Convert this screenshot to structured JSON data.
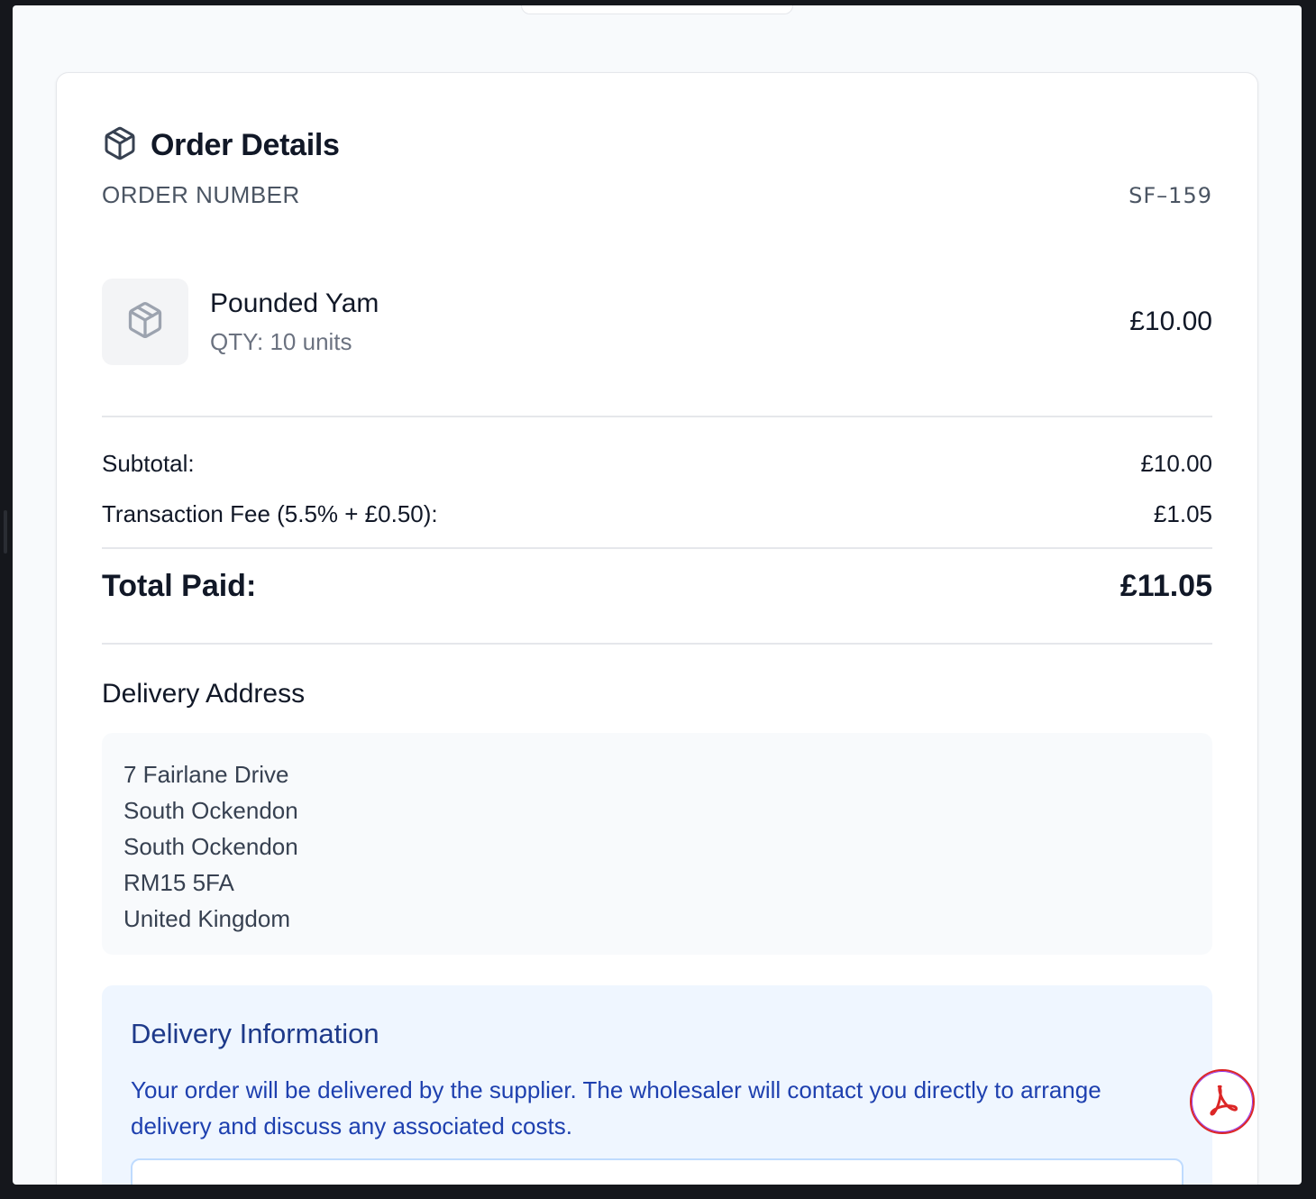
{
  "order": {
    "title": "Order Details",
    "number_label": "ORDER NUMBER",
    "number_value": "SF–159"
  },
  "item": {
    "name": "Pounded Yam",
    "qty": "QTY: 10 units",
    "price": "£10.00"
  },
  "summary": {
    "subtotal_label": "Subtotal:",
    "subtotal_value": "£10.00",
    "fee_label": "Transaction Fee (5.5% + £0.50):",
    "fee_value": "£1.05",
    "total_label": "Total Paid:",
    "total_value": "£11.05"
  },
  "address": {
    "heading": "Delivery Address",
    "lines": [
      "7 Fairlane Drive",
      "South Ockendon",
      "South Ockendon",
      "RM15 5FA",
      "United Kingdom"
    ]
  },
  "delivery_info": {
    "title": "Delivery Information",
    "text": "Your order will be delivered by the supplier. The wholesaler will contact you directly to arrange delivery and discuss any associated costs."
  },
  "icons": {
    "title_icon": "package-icon",
    "item_icon": "package-icon",
    "pdf_icon": "acrobat-pdf-icon"
  },
  "colors": {
    "info_bg": "#eff6ff",
    "info_title": "#1e3a8a",
    "info_text": "#1e40af",
    "pdf_red": "#dc2626"
  }
}
